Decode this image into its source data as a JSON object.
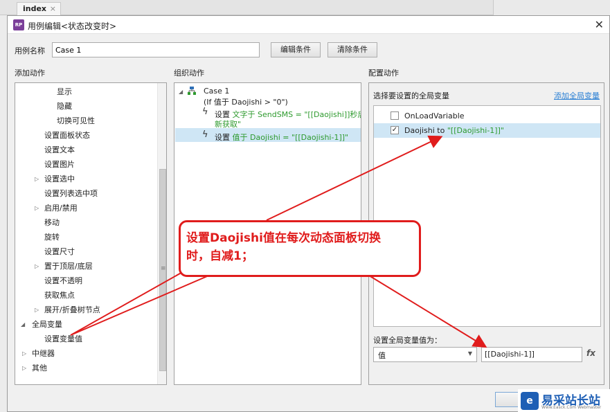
{
  "background": {
    "tab_label": "index",
    "tab_close": "×"
  },
  "dialog": {
    "app_icon": "RP",
    "title": "用例编辑<状态改变时>",
    "close": "✕",
    "case_name_label": "用例名称",
    "case_name_value": "Case 1",
    "edit_condition_button": "编辑条件",
    "clear_condition_button": "清除条件",
    "add_action_label": "添加动作",
    "organize_action_label": "组织动作",
    "configure_action_label": "配置动作"
  },
  "left_tree": {
    "items": [
      {
        "label": "显示"
      },
      {
        "label": "隐藏"
      },
      {
        "label": "切换可见性"
      },
      {
        "label": "设置面板状态"
      },
      {
        "label": "设置文本"
      },
      {
        "label": "设置图片"
      },
      {
        "label": "设置选中"
      },
      {
        "label": "设置列表选中项"
      },
      {
        "label": "启用/禁用"
      },
      {
        "label": "移动"
      },
      {
        "label": "旋转"
      },
      {
        "label": "设置尺寸"
      },
      {
        "label": "置于顶层/底层"
      },
      {
        "label": "设置不透明"
      },
      {
        "label": "获取焦点"
      },
      {
        "label": "展开/折叠树节点"
      },
      {
        "label": "全局变量"
      },
      {
        "label": "设置变量值"
      },
      {
        "label": "中继器"
      },
      {
        "label": "其他"
      }
    ],
    "scroll_grip": "≡"
  },
  "middle": {
    "case_title": "Case 1",
    "condition": "(If 值于 Daojishi > \"0\")",
    "action1_prefix": "设置 ",
    "action1_green_line1": "文字于 SendSMS = \"[[Daojishi]]秒后重",
    "action1_green_line2": "新获取\"",
    "action2_prefix": "设置 ",
    "action2_green": "值于 Daojishi = \"[[Daojishi-1]]\""
  },
  "right": {
    "header": "选择要设置的全局变量",
    "add_link": "添加全局变量",
    "variables": [
      {
        "name": "OnLoadVariable",
        "checked": false
      },
      {
        "name": "Daojishi to ",
        "value": "\"[[Daojishi-1]]\"",
        "checked": true
      }
    ],
    "set_label": "设置全局变量值为：",
    "select_value": "值",
    "input_value": "[[Daojishi-1]]",
    "fx": "fx"
  },
  "callout": {
    "line1": "设置Daojishi值在每次动态面板切换",
    "line2": "时，自减1；"
  },
  "watermark": {
    "title": "易采站长站",
    "sub": "Www.Easck.Com Webmaster"
  },
  "colors": {
    "accent_red": "#e01c1c",
    "selection": "#cfe6f5",
    "green_text": "#2e9a2e",
    "link_blue": "#2a7fd4"
  }
}
